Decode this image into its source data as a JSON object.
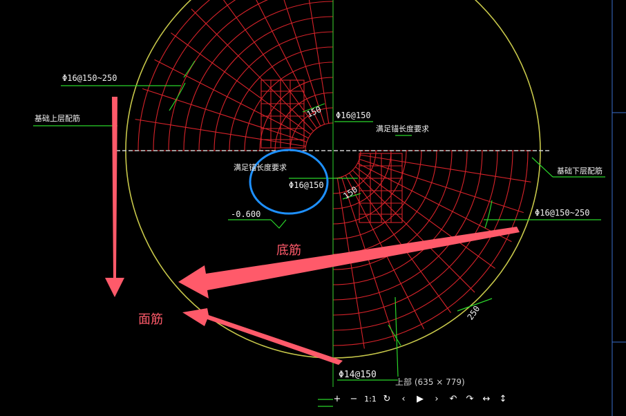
{
  "viewer": {
    "caption": "上部 (635 × 779)",
    "toolbar": [
      {
        "name": "zoom-in-button",
        "glyph": "+"
      },
      {
        "name": "zoom-out-button",
        "glyph": "−"
      },
      {
        "name": "actual-size-button",
        "glyph": "1:1"
      },
      {
        "name": "reset-button",
        "glyph": "↻"
      },
      {
        "name": "previous-button",
        "glyph": "‹"
      },
      {
        "name": "play-button",
        "glyph": "▶"
      },
      {
        "name": "next-button",
        "glyph": "›"
      },
      {
        "name": "rotate-left-button",
        "glyph": "↶"
      },
      {
        "name": "rotate-right-button",
        "glyph": "↷"
      },
      {
        "name": "flip-horizontal-button",
        "glyph": "↔"
      },
      {
        "name": "flip-vertical-button",
        "glyph": "↕"
      }
    ]
  },
  "drawing": {
    "labels": {
      "top_rebar_left": "Φ16@150~250",
      "foundation_top_left": "基础上层配筋",
      "rebar_center_top": "Φ16@150",
      "anchor_top": "满足锚长度要求",
      "spacing_top": "150",
      "anchor_mid": "满足锚长度要求",
      "rebar_circled": "Φ16@150",
      "spacing_mid": "150",
      "elevation": "-0.600",
      "foundation_bottom_right": "基础下层配筋",
      "bottom_rebar_right": "Φ16@150~250",
      "spacing_bottom": "250",
      "rebar_bottom": "Φ14@150"
    },
    "annotations": {
      "bottom_bars": "底筋",
      "top_bars": "面筋"
    },
    "colors": {
      "grid": "#d8232a",
      "dimension": "#2bd62b",
      "outline": "#c8c84a",
      "highlight_circle": "#1e90ff",
      "arrow": "#ff5a6a",
      "frame": "#3a6fd0"
    }
  }
}
